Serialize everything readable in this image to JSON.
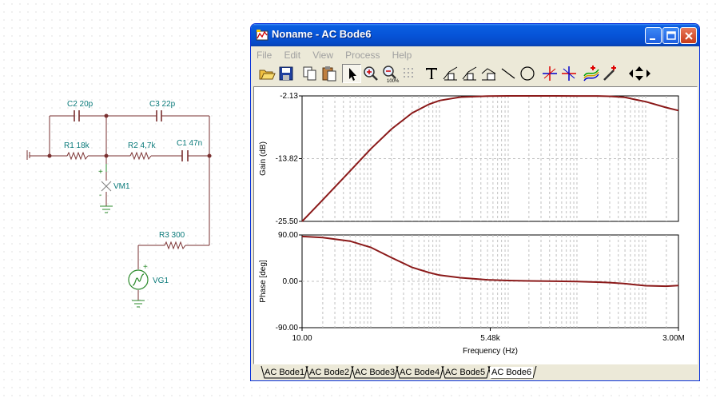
{
  "schematic": {
    "components": {
      "c2": "C2 20p",
      "c3": "C3 22p",
      "r1": "R1 18k",
      "r2": "R2 4,7k",
      "c1": "C1 47n",
      "vm1": "VM1",
      "r3": "R3 300",
      "vg1": "VG1"
    },
    "polarity": {
      "plus": "+",
      "minus": "-"
    }
  },
  "window": {
    "title": "Noname - AC Bode6",
    "menu": [
      "File",
      "Edit",
      "View",
      "Process",
      "Help"
    ],
    "toolbar_icons": [
      "open-icon",
      "save-icon",
      "copy-icon",
      "paste-icon",
      "pointer-icon",
      "zoom-in-icon",
      "zoom-out-icon",
      "grid-icon",
      "text-icon",
      "cursor-a-icon",
      "cursor-b-icon",
      "marker-icon",
      "line-icon",
      "circle-icon",
      "cursor-ab-a-icon",
      "cursor-ab-b-icon",
      "add-curve-icon",
      "probe-icon",
      "nav-arrows-icon"
    ]
  },
  "chart_data": [
    {
      "type": "line",
      "title": "",
      "xlabel": "",
      "ylabel": "Gain (dB)",
      "x_scale": "log",
      "xlim": [
        10,
        3000000
      ],
      "ylim": [
        -25.5,
        -2.13
      ],
      "yticks": [
        "-2.13",
        "-13.82",
        "-25.50"
      ],
      "grid": true,
      "series": [
        {
          "color": "#8b1a1a",
          "x": [
            10,
            20,
            50,
            100,
            200,
            400,
            700,
            1000,
            2000,
            5000,
            10000,
            20000,
            50000,
            100000,
            200000,
            300000,
            500000,
            700000,
            1000000,
            2000000,
            3000000
          ],
          "y": [
            -25.5,
            -21.5,
            -16.1,
            -12.0,
            -8.3,
            -5.3,
            -3.7,
            -3.0,
            -2.35,
            -2.17,
            -2.13,
            -2.13,
            -2.13,
            -2.14,
            -2.15,
            -2.2,
            -2.4,
            -2.8,
            -3.2,
            -4.3,
            -4.85
          ]
        }
      ]
    },
    {
      "type": "line",
      "title": "",
      "xlabel": "Frequency (Hz)",
      "ylabel": "Phase [deg]",
      "x_scale": "log",
      "xlim": [
        10,
        3000000
      ],
      "ylim": [
        -90,
        90
      ],
      "yticks": [
        "90.00",
        "0.00",
        "-90.00"
      ],
      "xticks": [
        "10.00",
        "5.48k",
        "3.00M"
      ],
      "grid": true,
      "series": [
        {
          "color": "#8b1a1a",
          "x": [
            10,
            20,
            50,
            100,
            200,
            400,
            700,
            1000,
            2000,
            5000,
            10000,
            20000,
            50000,
            100000,
            200000,
            300000,
            500000,
            700000,
            1000000,
            2000000,
            3000000
          ],
          "y": [
            87,
            85,
            78,
            66,
            46,
            27,
            17,
            12,
            7,
            3,
            1.5,
            0.7,
            0.1,
            -0.5,
            -1.5,
            -2.5,
            -4.5,
            -6.5,
            -8.5,
            -9.5,
            -8
          ]
        }
      ]
    }
  ],
  "tabs": [
    "AC Bode1",
    "AC Bode2",
    "AC Bode3",
    "AC Bode4",
    "AC Bode5",
    "AC Bode6"
  ],
  "active_tab": 5
}
